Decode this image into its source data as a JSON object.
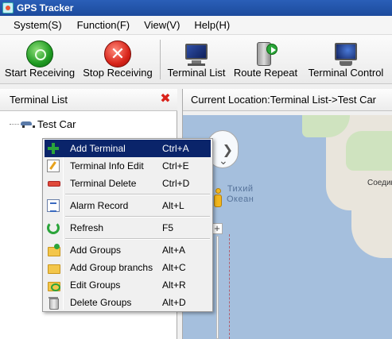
{
  "window": {
    "title": "GPS Tracker"
  },
  "menubar": {
    "items": [
      "System(S)",
      "Function(F)",
      "View(V)",
      "Help(H)"
    ]
  },
  "toolbar": {
    "start_receiving": "Start Receiving",
    "stop_receiving": "Stop Receiving",
    "terminal_list": "Terminal List",
    "route_repeat": "Route Repeat",
    "terminal_control": "Terminal Control"
  },
  "left_panel": {
    "title": "Terminal List",
    "tree": [
      {
        "label": "Test Car"
      }
    ]
  },
  "right_panel": {
    "title": "Current Location:Terminal List->Test Car"
  },
  "map": {
    "ocean_label_line1": "Тихий",
    "ocean_label_line2": "Океан",
    "city_label": "Соедин"
  },
  "context_menu": {
    "items": [
      {
        "label": "Add Terminal",
        "shortcut": "Ctrl+A",
        "selected": true
      },
      {
        "label": "Terminal Info Edit",
        "shortcut": "Ctrl+E"
      },
      {
        "label": "Terminal Delete",
        "shortcut": "Ctrl+D"
      },
      {
        "label": "Alarm Record",
        "shortcut": "Alt+L"
      },
      {
        "label": "Refresh",
        "shortcut": "F5"
      },
      {
        "label": "Add Groups",
        "shortcut": "Alt+A"
      },
      {
        "label": "Add Group branchs",
        "shortcut": "Alt+C"
      },
      {
        "label": "Edit Groups",
        "shortcut": "Alt+R"
      },
      {
        "label": "Delete Groups",
        "shortcut": "Alt+D"
      }
    ]
  },
  "colors": {
    "titlebar": "#1c4a9c",
    "menu_selection": "#0a246a",
    "ocean": "#a5bfdd",
    "land": "#e9e5dc"
  }
}
